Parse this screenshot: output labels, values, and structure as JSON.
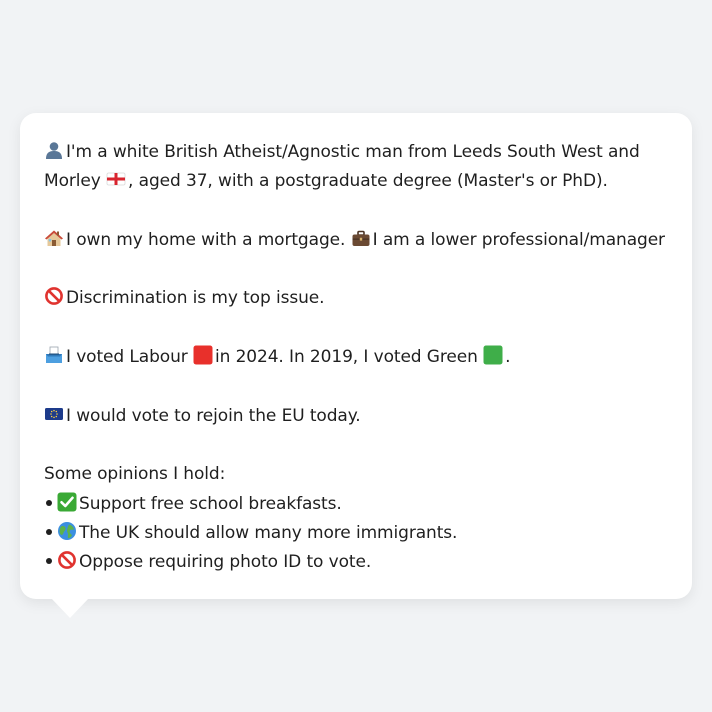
{
  "profile": {
    "identity": {
      "icon": "bust-silhouette-icon",
      "text_a": "I'm a white British Atheist/Agnostic man from Leeds South West and Morley",
      "flag_icon": "england-flag-icon",
      "text_b": ", aged 37, with a postgraduate degree (Master's or PhD)."
    },
    "home": {
      "icon": "house-icon",
      "text": "I own my home with a mortgage.",
      "job_icon": "briefcase-icon",
      "job_text": "I am a lower professional/manager"
    },
    "issue": {
      "icon": "prohibited-icon",
      "text": "Discrimination is my top issue."
    },
    "vote": {
      "icon": "ballot-box-icon",
      "text_a": "I voted Labour",
      "labour_icon": "red-square-icon",
      "text_b": "in 2024. In 2019, I voted Green",
      "green_icon": "green-square-icon",
      "text_c": "."
    },
    "eu": {
      "icon": "eu-flag-icon",
      "text": "I would vote to rejoin the EU today."
    },
    "opinions": {
      "heading": "Some opinions I hold:",
      "items": [
        {
          "icon": "check-mark-button-icon",
          "text": "Support free school breakfasts."
        },
        {
          "icon": "globe-icon",
          "text": "The UK should allow many more immigrants."
        },
        {
          "icon": "prohibited-icon",
          "text": "Oppose requiring photo ID to vote."
        }
      ]
    }
  },
  "colors": {
    "background": "#f1f3f5",
    "bubble": "#ffffff",
    "text": "#1f1f1f",
    "labour_red": "#e8302b",
    "green": "#3fae49",
    "eu_blue": "#1d3b8b",
    "check_green": "#3aa935"
  }
}
